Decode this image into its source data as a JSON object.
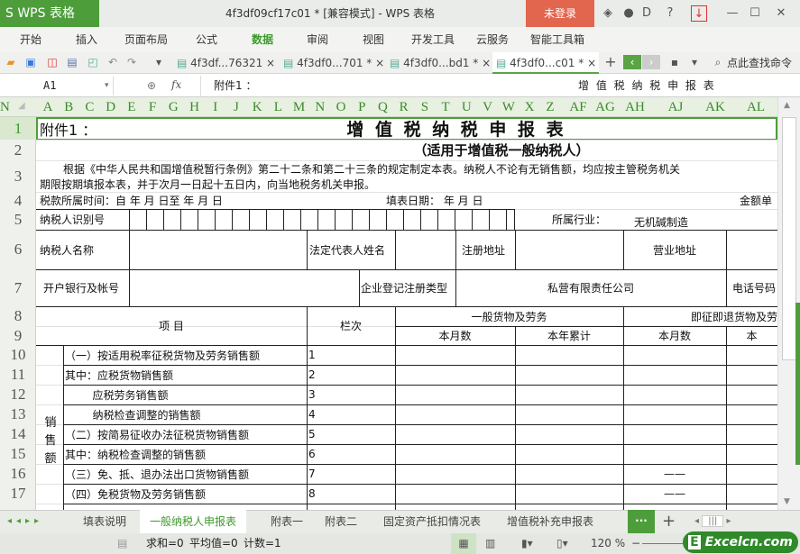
{
  "app": {
    "logo": "S WPS 表格",
    "title": "4f3df09cf17c01 * [兼容模式] - WPS 表格",
    "login": "未登录"
  },
  "menu": [
    "开始",
    "插入",
    "页面布局",
    "公式",
    "数据",
    "审阅",
    "视图",
    "开发工具",
    "云服务",
    "智能工具箱"
  ],
  "menu_active": "数据",
  "doc_tabs": [
    "4f3df...76321 ×",
    "4f3df0...701 * ×",
    "4f3df0...bd1 * ×",
    "4f3df0...c01 * ×"
  ],
  "search_cmd": "点此查找命令",
  "formula": {
    "cell": "A1",
    "fx": "fx",
    "content_left": "附件1  ：",
    "content_right": "增 值 税 纳 税 申 报 表"
  },
  "columns": [
    "A",
    "B",
    "C",
    "D",
    "E",
    "F",
    "G",
    "H",
    "I",
    "J",
    "K",
    "L",
    "M",
    "N",
    "O",
    "P",
    "Q",
    "R",
    "S",
    "T",
    "U",
    "V",
    "W",
    "X",
    "Z",
    "AF",
    "AG",
    "AH",
    "AJ",
    "AK",
    "AL",
    "AN"
  ],
  "rows": [
    "1",
    "2",
    "3",
    "4",
    "5",
    "6",
    "7",
    "8",
    "9",
    "10",
    "11",
    "12",
    "13",
    "14",
    "15",
    "16",
    "17"
  ],
  "sheet": {
    "a1": "附件1  ：",
    "title": "增 值 税 纳 税 申 报 表",
    "subtitle": "（适用于增值税一般纳税人）",
    "intro1": "根据《中华人民共和国增值税暂行条例》第二十二条和第二十三条的规定制定本表。纳税人不论有无销售额，均应按主管税务机关",
    "intro2": "期限按期填报本表，并于次月一日起十五日内，向当地税务机关申报。",
    "period": "税款所属时间：自     年   月   日至    年  月  日",
    "fill_date": "填表日期：     年    月    日",
    "unit": "金额单",
    "taxpayer_id": "纳税人识别号",
    "industry_label": "所属行业：",
    "industry_value": "无机碱制造",
    "taxpayer_name": "纳税人名称",
    "legal_rep": "法定代表人姓名",
    "reg_addr": "注册地址",
    "biz_addr": "营业地址",
    "bank": "开户银行及帐号",
    "reg_type_label": "企业登记注册类型",
    "reg_type_value": "私营有限责任公司",
    "phone": "电话号码",
    "item": "项    目",
    "col_no": "栏次",
    "general": "一般货物及劳务",
    "immediate": "即征即退货物及劳",
    "month": "本月数",
    "ytd": "本年累计",
    "month2": "本月数",
    "ytd2": "本",
    "sales_group": "销售额",
    "lines": [
      {
        "label": "（一）按适用税率征税货物及劳务销售额",
        "no": "1",
        "dash": ""
      },
      {
        "label": "其中：应税货物销售额",
        "no": "2",
        "dash": ""
      },
      {
        "label": "        应税劳务销售额",
        "no": "3",
        "dash": ""
      },
      {
        "label": "        纳税检查调整的销售额",
        "no": "4",
        "dash": ""
      },
      {
        "label": "（二）按简易征收办法征税货物销售额",
        "no": "5",
        "dash": ""
      },
      {
        "label": "其中：纳税检查调整的销售额",
        "no": "6",
        "dash": ""
      },
      {
        "label": "（三）免、抵、退办法出口货物销售额",
        "no": "7",
        "dash": "——"
      },
      {
        "label": "（四）免税货物及劳务销售额",
        "no": "8",
        "dash": "——"
      }
    ]
  },
  "sheet_tabs": [
    "填表说明",
    "一般纳税人申报表",
    "附表一",
    "附表二",
    "固定资产抵扣情况表",
    "增值税补充申报表"
  ],
  "active_sheet": "一般纳税人申报表",
  "status": {
    "sum": "求和=0",
    "avg": "平均值=0",
    "count": "计数=1",
    "zoom": "120 %"
  },
  "watermark": "Excelcn.com",
  "colors": {
    "accent": "#4d9e3b",
    "login": "#e2664d"
  }
}
